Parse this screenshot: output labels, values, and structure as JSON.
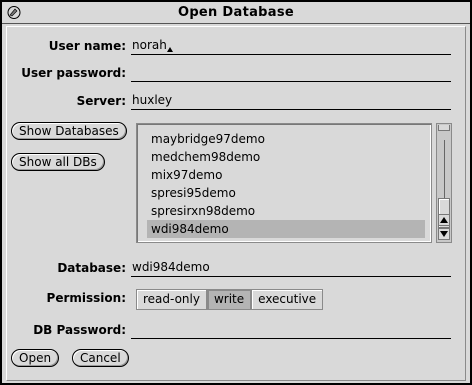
{
  "window": {
    "title": "Open Database"
  },
  "form": {
    "user_name_label": "User name:",
    "user_name_value": "norah",
    "user_password_label": "User password:",
    "user_password_value": "",
    "server_label": "Server:",
    "server_value": "huxley",
    "database_label": "Database:",
    "database_value": "wdi984demo",
    "permission_label": "Permission:",
    "db_password_label": "DB Password:",
    "db_password_value": ""
  },
  "side_buttons": {
    "show_databases": "Show Databases",
    "show_all_dbs": "Show all DBs"
  },
  "databases": {
    "items": [
      "maybridge97demo",
      "medchem98demo",
      "mix97demo",
      "spresi95demo",
      "spresirxn98demo",
      "wdi984demo"
    ],
    "selected": "wdi984demo"
  },
  "permission": {
    "options": [
      "read-only",
      "write",
      "executive"
    ],
    "selected": "write"
  },
  "footer": {
    "open_label": "Open",
    "cancel_label": "Cancel"
  }
}
